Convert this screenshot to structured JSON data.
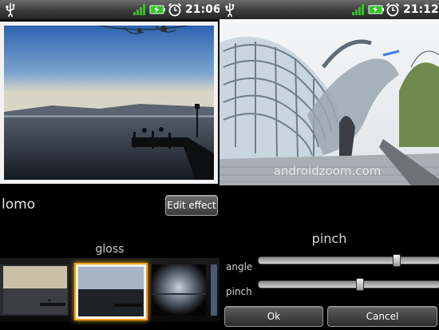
{
  "left": {
    "status_time": "21:06",
    "effect_name": "lomo",
    "edit_effect_label": "Edit effect",
    "selected_effect": "gloss",
    "thumbnails": [
      "lomo-thumb",
      "gloss-thumb",
      "vignette-thumb"
    ]
  },
  "right": {
    "status_time": "21:12",
    "watermark": "androidzoom.com",
    "effect_title": "pinch",
    "sliders": [
      {
        "label": "angle",
        "value": 0.77
      },
      {
        "label": "pinch",
        "value": 0.56
      }
    ],
    "ok_label": "Ok",
    "cancel_label": "Cancel"
  },
  "colors": {
    "status_icon_green": "#39c02a",
    "background": "#000000"
  }
}
